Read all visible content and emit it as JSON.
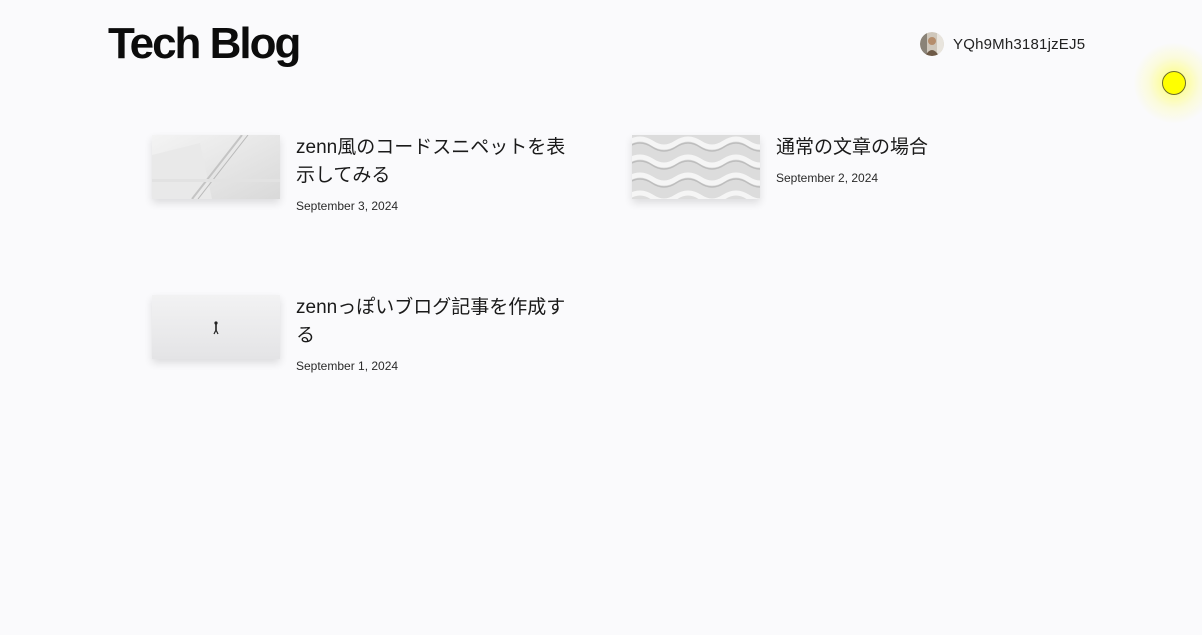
{
  "header": {
    "site_title": "Tech Blog",
    "user": {
      "username": "YQh9Mh3181jzEJ5",
      "avatar_icon": "avatar-photo"
    }
  },
  "posts": [
    {
      "title": "zenn風のコードスニペットを表示してみる",
      "date": "September 3, 2024",
      "thumbnail_icon": "white-architecture-image"
    },
    {
      "title": "通常の文章の場合",
      "date": "September 2, 2024",
      "thumbnail_icon": "white-pattern-image"
    },
    {
      "title": "zennっぽいブログ記事を作成する",
      "date": "September 1, 2024",
      "thumbnail_icon": "person-walking-snow-image"
    }
  ],
  "colors": {
    "background": "#fafafc",
    "cursor_highlight": "#ffff00"
  }
}
